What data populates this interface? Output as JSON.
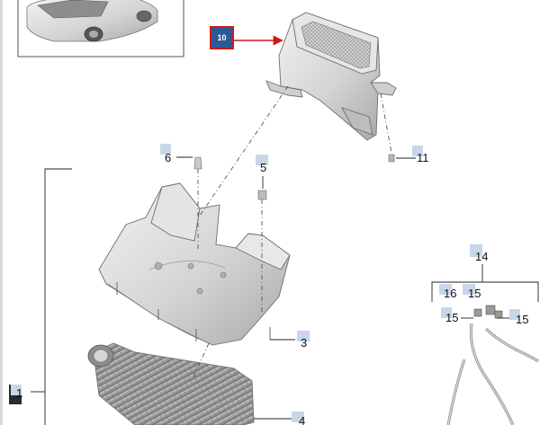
{
  "diagram": {
    "highlighted_callout": "10",
    "callouts": [
      {
        "id": "c1",
        "label": "1"
      },
      {
        "id": "c3",
        "label": "3"
      },
      {
        "id": "c4",
        "label": "4"
      },
      {
        "id": "c5",
        "label": "5"
      },
      {
        "id": "c6",
        "label": "6"
      },
      {
        "id": "c11",
        "label": "11"
      },
      {
        "id": "c14",
        "label": "14"
      },
      {
        "id": "c15a",
        "label": "15"
      },
      {
        "id": "c15b",
        "label": "15"
      },
      {
        "id": "c15c",
        "label": "15"
      },
      {
        "id": "c16",
        "label": "16"
      }
    ],
    "colors": {
      "callout_box": "#c7d6e9",
      "highlight_box": "#2a5a9a",
      "highlight_border": "#d01818",
      "arrow": "#d01818",
      "part_fill": "#d9d9d9"
    },
    "icons": [
      "car-thumbnail-icon"
    ]
  }
}
